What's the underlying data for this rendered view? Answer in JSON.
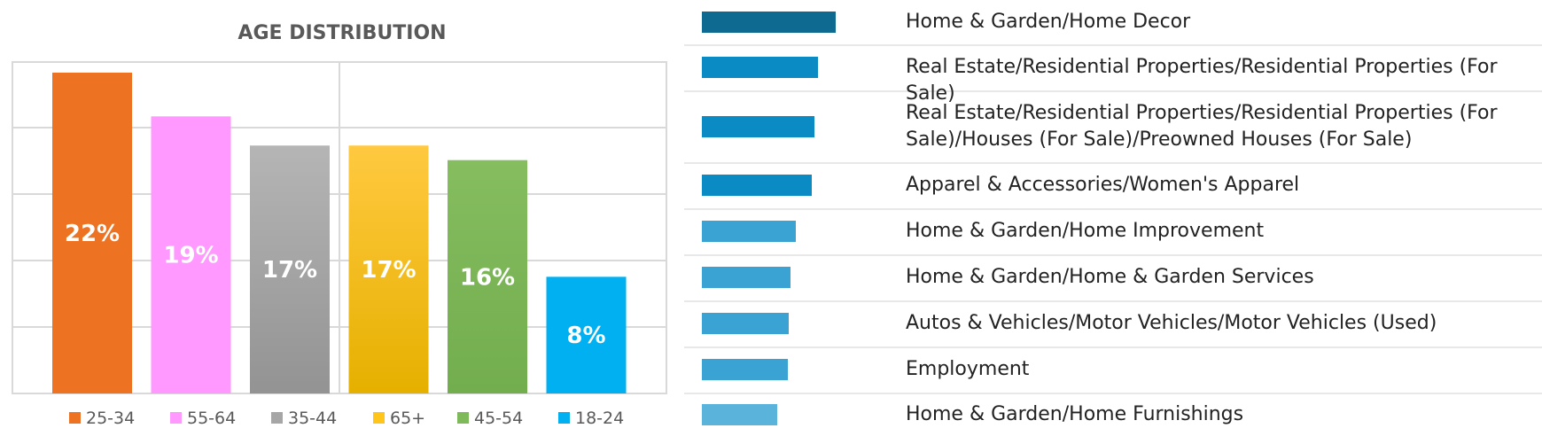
{
  "chart_data": {
    "type": "bar",
    "title": "AGE DISTRIBUTION",
    "categories": [
      "25-34",
      "55-64",
      "35-44",
      "65+",
      "45-54",
      "18-24"
    ],
    "values": [
      22,
      19,
      17,
      17,
      16,
      8
    ],
    "labels": [
      "22%",
      "19%",
      "17%",
      "17%",
      "16%",
      "8%"
    ],
    "colors": [
      "#ed7322",
      "#ff99ff",
      "#a6a6a6",
      "#ffc51a",
      "#7eb95a",
      "#00b0f0"
    ],
    "ylim": [
      0,
      25
    ],
    "grid": true,
    "legend": "bottom"
  },
  "interest_list": {
    "items": [
      {
        "label": "Home & Garden/Home Decor",
        "value": 100,
        "color": "#0f6a92"
      },
      {
        "label": "Real Estate/Residential Properties/Residential Properties (For Sale)",
        "value": 87,
        "color": "#0b8bc4"
      },
      {
        "label": "Real Estate/Residential Properties/Residential Properties (For Sale)/Houses (For Sale)/Preowned Houses (For Sale)",
        "value": 84,
        "color": "#0b8bc4"
      },
      {
        "label": "Apparel & Accessories/Women's Apparel",
        "value": 82,
        "color": "#0b8bc4"
      },
      {
        "label": "Home & Garden/Home Improvement",
        "value": 70,
        "color": "#3aa3d3"
      },
      {
        "label": "Home & Garden/Home & Garden Services",
        "value": 66,
        "color": "#3aa3d3"
      },
      {
        "label": "Autos & Vehicles/Motor Vehicles/Motor Vehicles (Used)",
        "value": 65,
        "color": "#3aa3d3"
      },
      {
        "label": "Employment",
        "value": 64,
        "color": "#3aa3d3"
      },
      {
        "label": "Home & Garden/Home Furnishings",
        "value": 56,
        "color": "#5ab3da"
      }
    ]
  }
}
